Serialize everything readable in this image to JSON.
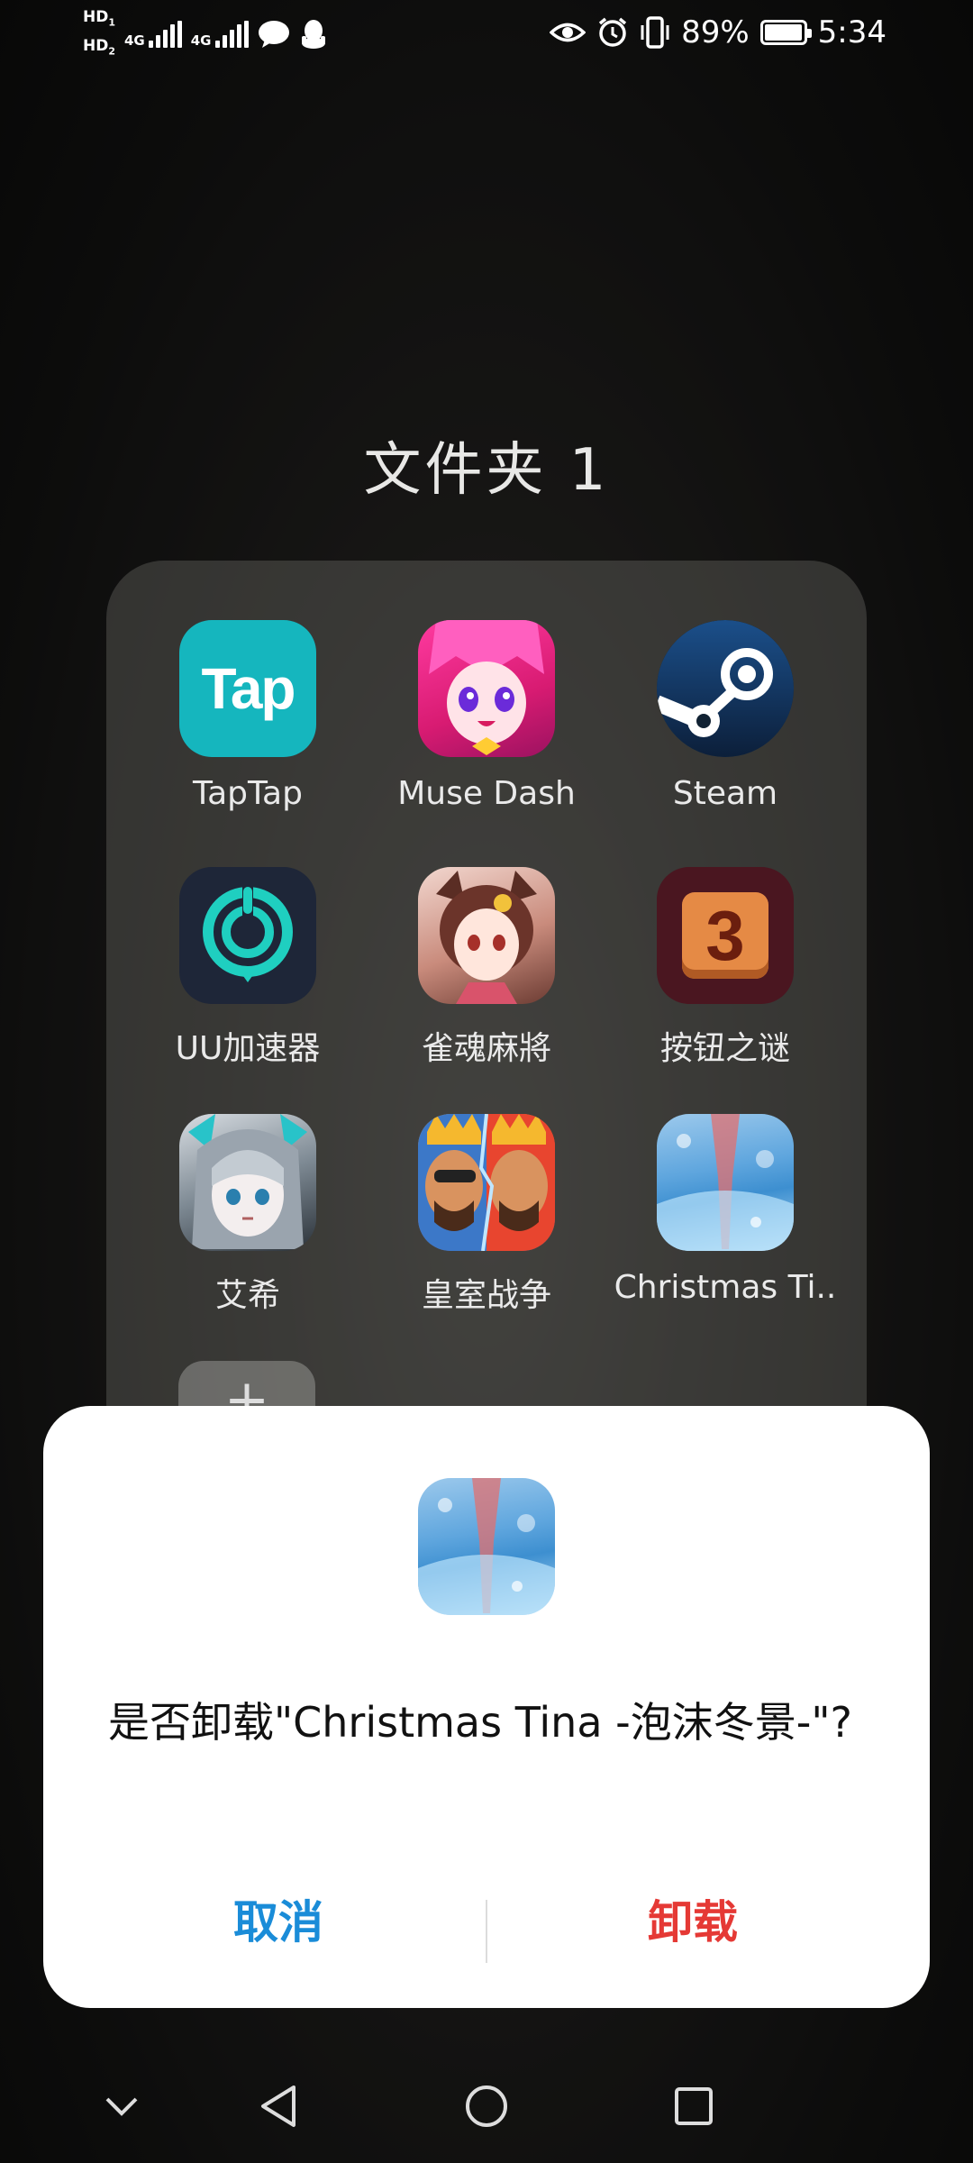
{
  "status_bar": {
    "sim1": "HD",
    "sim1_index": "1",
    "sim2": "HD",
    "sim2_index": "2",
    "network1": "4G",
    "network2": "4G",
    "battery": "89%",
    "battery_level": 0.89,
    "time": "5:34",
    "icons": [
      "message-icon",
      "qq-icon",
      "eye-icon",
      "alarm-icon",
      "vibrate-icon",
      "battery-icon"
    ]
  },
  "folder": {
    "title": "文件夹 1",
    "apps": [
      {
        "label": "TapTap",
        "icon": "taptap-icon",
        "icon_text": "Tap"
      },
      {
        "label": "Muse Dash",
        "icon": "muse-dash-icon"
      },
      {
        "label": "Steam",
        "icon": "steam-icon"
      },
      {
        "label": "UU加速器",
        "icon": "uu-accelerator-icon"
      },
      {
        "label": "雀魂麻將",
        "icon": "mahjong-soul-icon"
      },
      {
        "label": "按钮之谜",
        "icon": "button-puzzle-icon",
        "icon_text": "3"
      },
      {
        "label": "艾希",
        "icon": "aixi-icon"
      },
      {
        "label": "皇室战争",
        "icon": "clash-royale-icon"
      },
      {
        "label": "Christmas Ti..",
        "icon": "christmas-tina-icon"
      }
    ],
    "add_symbol": "+"
  },
  "dialog": {
    "message": "是否卸载\"Christmas Tina -泡沫冬景-\"?",
    "cancel_label": "取消",
    "confirm_label": "卸载",
    "colors": {
      "cancel": "#1a8cd8",
      "confirm": "#e53935"
    }
  },
  "nav_bar": {
    "icons": [
      "collapse-chevron-icon",
      "back-triangle-icon",
      "home-circle-icon",
      "recents-square-icon"
    ]
  }
}
